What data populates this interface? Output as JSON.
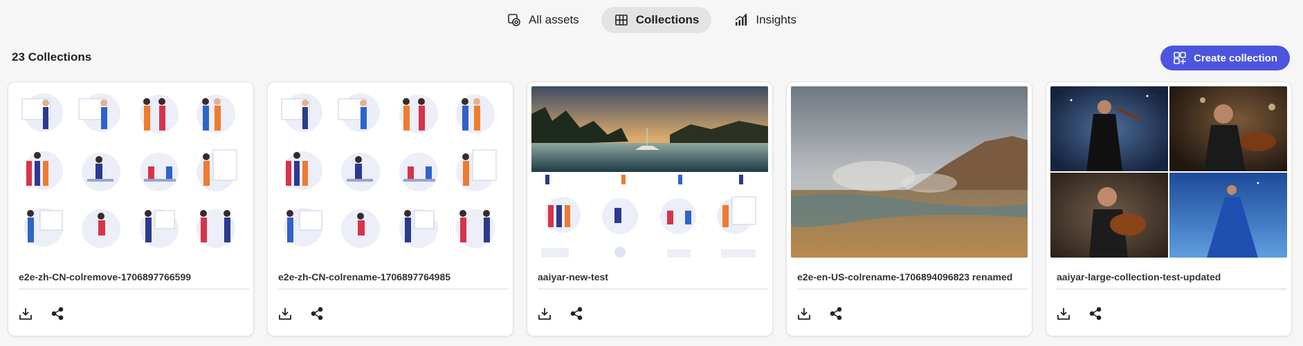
{
  "nav": {
    "tabs": [
      {
        "label": "All assets",
        "icon": "assets-icon",
        "active": false
      },
      {
        "label": "Collections",
        "icon": "grid-icon",
        "active": true
      },
      {
        "label": "Insights",
        "icon": "insights-icon",
        "active": false
      }
    ]
  },
  "header": {
    "count_label": "23 Collections",
    "create_label": "Create collection"
  },
  "colors": {
    "accent": "#4b55e0",
    "active_tab_bg": "#e3e3e3",
    "page_bg": "#f6f6f6"
  },
  "collections": [
    {
      "title": "e2e-zh-CN-colremove-1706897766599",
      "thumbnail": "illustration-grid"
    },
    {
      "title": "e2e-zh-CN-colrename-1706897764985",
      "thumbnail": "illustration-grid"
    },
    {
      "title": "aaiyar-new-test",
      "thumbnail": "lake-over-illustrations"
    },
    {
      "title": "e2e-en-US-colrename-1706894096823 renamed",
      "thumbnail": "geothermal-landscape"
    },
    {
      "title": "aaiyar-large-collection-test-updated",
      "thumbnail": "violinist-quad"
    }
  ],
  "card_actions": [
    "download-icon",
    "share-icon"
  ]
}
